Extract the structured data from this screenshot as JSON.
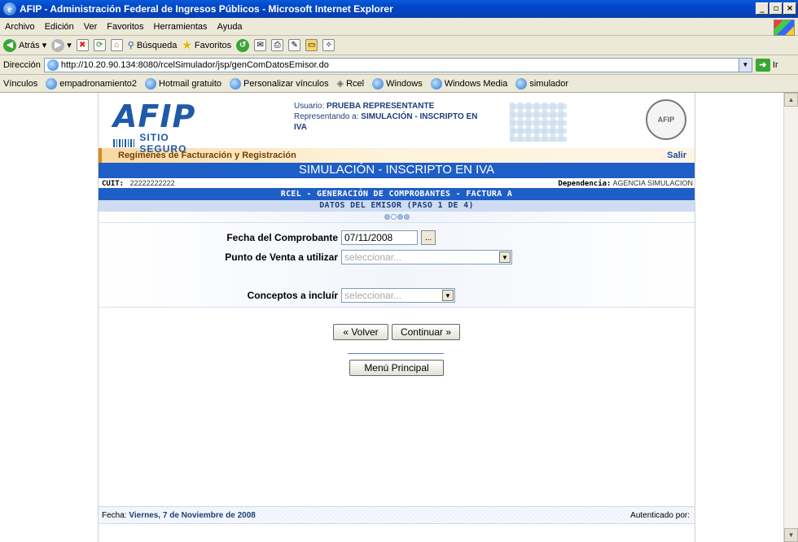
{
  "window": {
    "title": "AFIP - Administración Federal de Ingresos Públicos - Microsoft Internet Explorer",
    "minimize": "_",
    "maximize": "▫",
    "close": "×"
  },
  "menu": [
    "Archivo",
    "Edición",
    "Ver",
    "Favoritos",
    "Herramientas",
    "Ayuda"
  ],
  "toolbar": {
    "back": "Atrás",
    "search": "Búsqueda",
    "favorites": "Favoritos"
  },
  "address": {
    "label": "Dirección",
    "url": "http://10.20.90.134:8080/rcelSimulador/jsp/genComDatosEmisor.do",
    "go": "Ir"
  },
  "links": {
    "label": "Vínculos",
    "items": [
      "empadronamiento2",
      "Hotmail gratuito",
      "Personalizar vínculos",
      "Rcel",
      "Windows",
      "Windows Media",
      "simulador"
    ]
  },
  "header": {
    "logo": "AFIP",
    "logo_sub": "SITIO SEGURO",
    "user_label": "Usuario:",
    "user_name": "PRUEBA REPRESENTANTE",
    "represent_label": "Representando a:",
    "represent_name": "SIMULACIÓN - INSCRIPTO EN",
    "represent_name2": "IVA",
    "seal_text": "AFIP"
  },
  "regbar": {
    "title": "Regímenes de Facturación y Registración",
    "salir": "Salir"
  },
  "page_title": "SIMULACIÓN - INSCRIPTO EN IVA",
  "cuit": {
    "label": "CUIT:",
    "value": "22222222222",
    "dep_label": "Dependencia:",
    "dep_value": "AGENCIA SIMULACION"
  },
  "subtitle1": "RCEL - GENERACIÓN DE COMPROBANTES - FACTURA A",
  "subtitle2": "DATOS DEL EMISOR (PASO 1 DE 4)",
  "steps": {
    "current": 1,
    "total": 4
  },
  "form": {
    "fecha_label": "Fecha del Comprobante",
    "fecha_value": "07/11/2008",
    "calendar_btn": "...",
    "punto_label": "Punto de Venta a utilizar",
    "punto_value": "seleccionar...",
    "conceptos_label": "Conceptos a incluír",
    "conceptos_value": "seleccionar..."
  },
  "buttons": {
    "volver": "« Volver",
    "continuar": "Continuar »",
    "menu_principal": "Menú Principal"
  },
  "footer": {
    "fecha_label": "Fecha:",
    "fecha_value": "Viernes, 7 de Noviembre de 2008",
    "auth": "Autenticado por:"
  }
}
